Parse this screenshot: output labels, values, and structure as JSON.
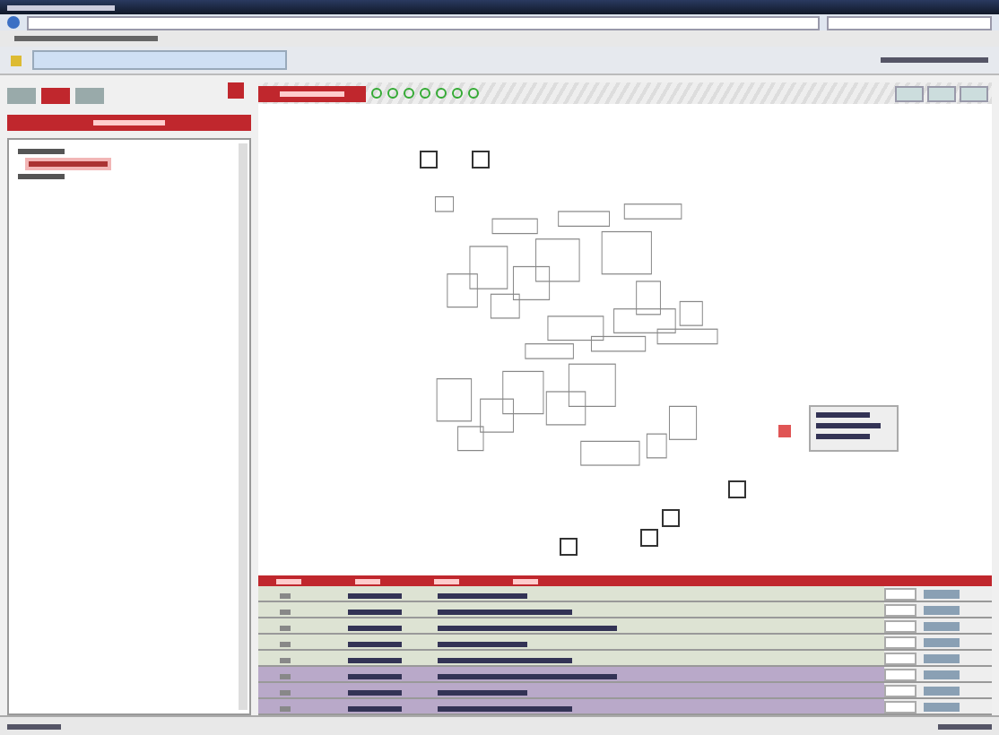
{
  "left_panel": {
    "tabs": [
      {
        "selected": false
      },
      {
        "selected": true
      },
      {
        "selected": false
      }
    ],
    "tree": [
      {
        "selected": false,
        "children": [
          {
            "selected": true
          }
        ]
      },
      {
        "selected": false
      }
    ]
  },
  "viewer": {
    "status_lights": [
      {
        "on": true
      },
      {
        "on": true
      },
      {
        "on": true
      },
      {
        "on": true
      },
      {
        "on": true
      },
      {
        "on": true
      },
      {
        "on": true
      }
    ]
  },
  "table": {
    "rows": [
      {
        "color": "#dde3d3"
      },
      {
        "color": "#dde3d3"
      },
      {
        "color": "#dde3d3"
      },
      {
        "color": "#dde3d3"
      },
      {
        "color": "#dde3d3"
      },
      {
        "color": "#b9a9c9"
      },
      {
        "color": "#b9a9c9"
      },
      {
        "color": "#b9a9c9"
      }
    ]
  }
}
